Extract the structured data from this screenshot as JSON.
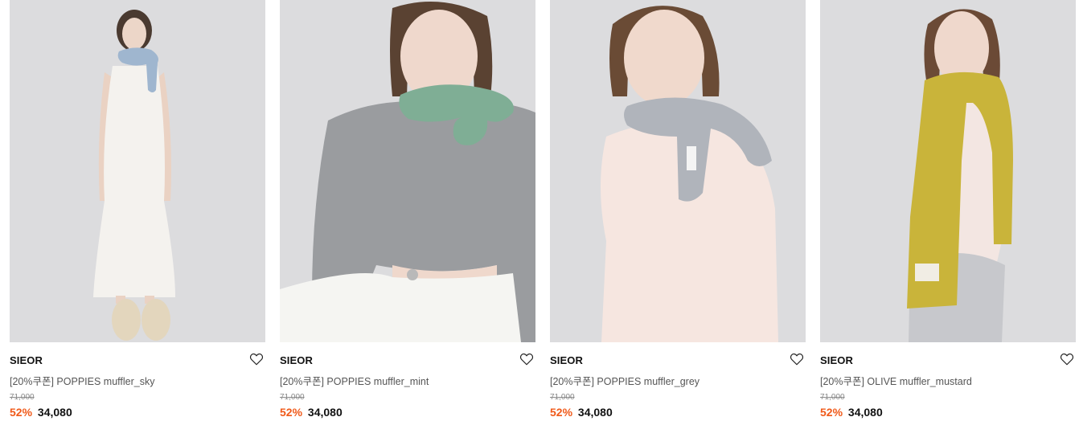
{
  "products": [
    {
      "brand": "SIEOR",
      "name": "[20%쿠폰] POPPIES muffler_sky",
      "original_price": "71,000",
      "discount": "52%",
      "price": "34,080",
      "scarf_color": "#9fb6cf",
      "wishlisted": false
    },
    {
      "brand": "SIEOR",
      "name": "[20%쿠폰] POPPIES muffler_mint",
      "original_price": "71,000",
      "discount": "52%",
      "price": "34,080",
      "scarf_color": "#7fae95",
      "wishlisted": false
    },
    {
      "brand": "SIEOR",
      "name": "[20%쿠폰] POPPIES muffler_grey",
      "original_price": "71,000",
      "discount": "52%",
      "price": "34,080",
      "scarf_color": "#b0b4bb",
      "wishlisted": false
    },
    {
      "brand": "SIEOR",
      "name": "[20%쿠폰] OLIVE muffler_mustard",
      "original_price": "71,000",
      "discount": "52%",
      "price": "34,080",
      "scarf_color": "#c9b43a",
      "wishlisted": false
    }
  ],
  "colors": {
    "discount": "#f05a1a",
    "photo_background": "#d9d9db"
  },
  "icons": {
    "wishlist": "heart-outline-icon"
  }
}
